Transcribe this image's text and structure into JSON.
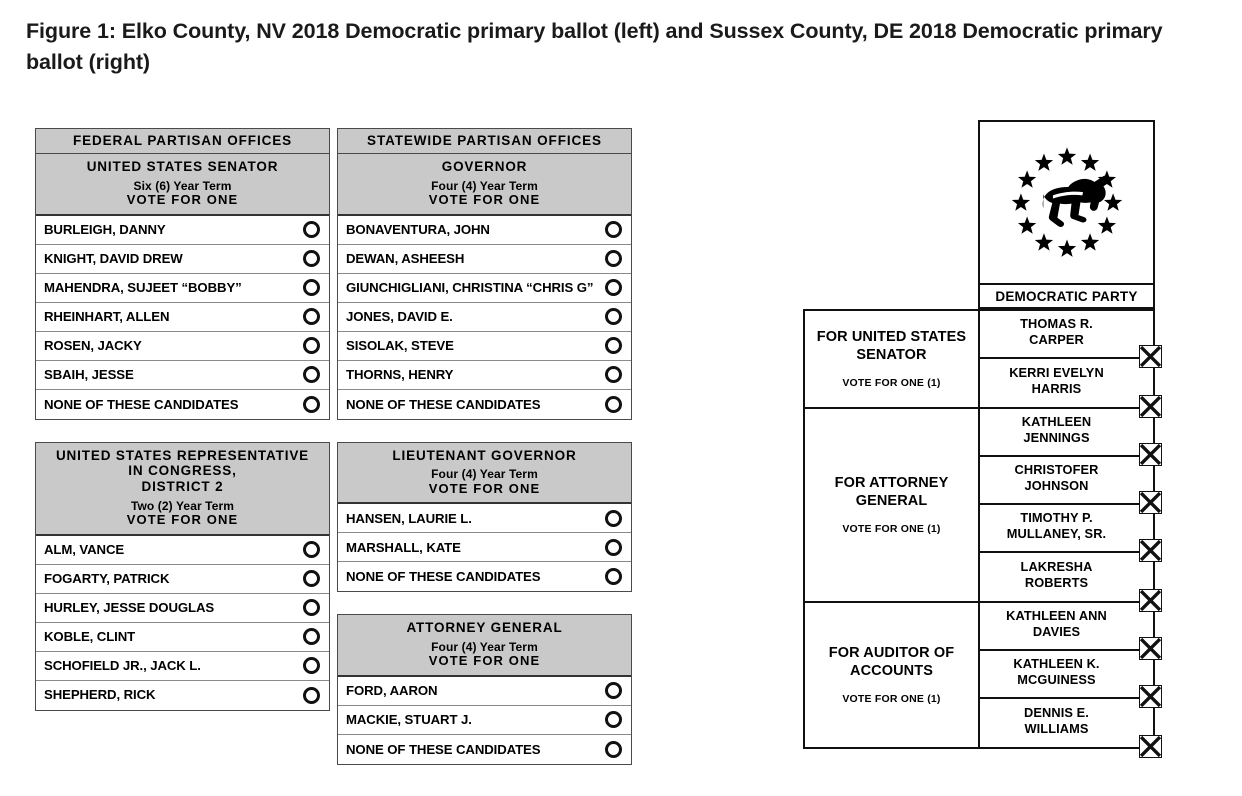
{
  "figure": {
    "caption": "Figure 1: Elko County, NV 2018 Democratic primary ballot (left) and Sussex County, DE 2018 Democratic primary ballot (right)"
  },
  "nevada_ballot": {
    "columns": [
      {
        "contests": [
          {
            "banner": "FEDERAL  PARTISAN  OFFICES",
            "office": "UNITED  STATES  SENATOR",
            "term": "Six (6) Year Term",
            "instruction": "VOTE  FOR  ONE",
            "candidates": [
              "BURLEIGH, DANNY",
              "KNIGHT, DAVID DREW",
              "MAHENDRA, SUJEET “BOBBY”",
              "RHEINHART, ALLEN",
              "ROSEN, JACKY",
              "SBAIH, JESSE",
              "NONE OF THESE CANDIDATES"
            ]
          },
          {
            "banner": null,
            "office": "UNITED  STATES  REPRESENTATIVE\nIN  CONGRESS,\nDISTRICT 2",
            "term": "Two (2) Year Term",
            "instruction": "VOTE  FOR  ONE",
            "candidates": [
              "ALM, VANCE",
              "FOGARTY, PATRICK",
              "HURLEY, JESSE DOUGLAS",
              "KOBLE, CLINT",
              "SCHOFIELD JR., JACK L.",
              "SHEPHERD, RICK"
            ]
          }
        ]
      },
      {
        "contests": [
          {
            "banner": "STATEWIDE  PARTISAN  OFFICES",
            "office": "GOVERNOR",
            "term": "Four (4) Year Term",
            "instruction": "VOTE  FOR  ONE",
            "candidates": [
              "BONAVENTURA, JOHN",
              "DEWAN, ASHEESH",
              "GIUNCHIGLIANI, CHRISTINA “CHRIS G”",
              "JONES, DAVID E.",
              "SISOLAK, STEVE",
              "THORNS, HENRY",
              "NONE OF THESE CANDIDATES"
            ]
          },
          {
            "banner": null,
            "office": "LIEUTENANT  GOVERNOR",
            "term": "Four (4) Year Term",
            "instruction": "VOTE  FOR  ONE",
            "candidates": [
              "HANSEN, LAURIE L.",
              "MARSHALL, KATE",
              "NONE OF THESE CANDIDATES"
            ]
          },
          {
            "banner": null,
            "office": "ATTORNEY GENERAL",
            "term": "Four (4) Year Term",
            "instruction": "VOTE  FOR  ONE",
            "candidates": [
              "FORD, AARON",
              "MACKIE, STUART J.",
              "NONE OF THESE CANDIDATES"
            ]
          }
        ]
      }
    ]
  },
  "delaware_ballot": {
    "party_label": "DEMOCRATIC PARTY",
    "logo_icon": "democratic-donkey-stars-icon",
    "contests": [
      {
        "office": "FOR UNITED STATES\nSENATOR",
        "instruction": "VOTE FOR ONE (1)",
        "candidates": [
          "THOMAS R.\nCARPER",
          "KERRI EVELYN\nHARRIS"
        ]
      },
      {
        "office": "FOR ATTORNEY\nGENERAL",
        "instruction": "VOTE FOR ONE (1)",
        "candidates": [
          "KATHLEEN\nJENNINGS",
          "CHRISTOFER\nJOHNSON",
          "TIMOTHY P.\nMULLANEY, SR.",
          "LAKRESHA\nROBERTS"
        ]
      },
      {
        "office": "FOR AUDITOR OF\nACCOUNTS",
        "instruction": "VOTE FOR ONE (1)",
        "candidates": [
          "KATHLEEN ANN\nDAVIES",
          "KATHLEEN K.\nMCGUINESS",
          "DENNIS E.\nWILLIAMS"
        ]
      }
    ]
  },
  "colors": {
    "header_gray": "#c9c9c9",
    "border_dark": "#111111",
    "border_mid": "#4a4a4a",
    "page_background": "#ffffff"
  }
}
